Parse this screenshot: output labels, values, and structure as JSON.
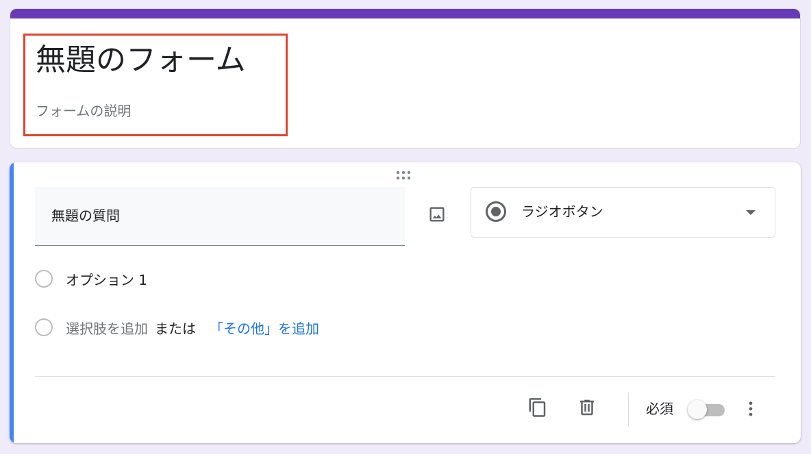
{
  "header": {
    "title": "無題のフォーム",
    "description": "フォームの説明"
  },
  "question": {
    "title": "無題の質問",
    "type_label": "ラジオボタン",
    "options": [
      {
        "label": "オプション 1"
      }
    ],
    "add_option_label": "選択肢を追加",
    "or_label": "または",
    "add_other_label": "「その他」を追加",
    "required_label": "必須",
    "required": false
  },
  "icons": {
    "drag": "drag-handle-icon",
    "image": "image-icon",
    "radio_type": "radio-button-checked-icon",
    "dropdown": "arrow-drop-down-icon",
    "copy": "copy-icon",
    "delete": "trash-icon",
    "more": "more-vert-icon"
  },
  "colors": {
    "theme": "#673ab7",
    "active_accent": "#4285f4",
    "link": "#1a73e8",
    "highlight": "#e0432f",
    "background": "#f0ebf8"
  }
}
